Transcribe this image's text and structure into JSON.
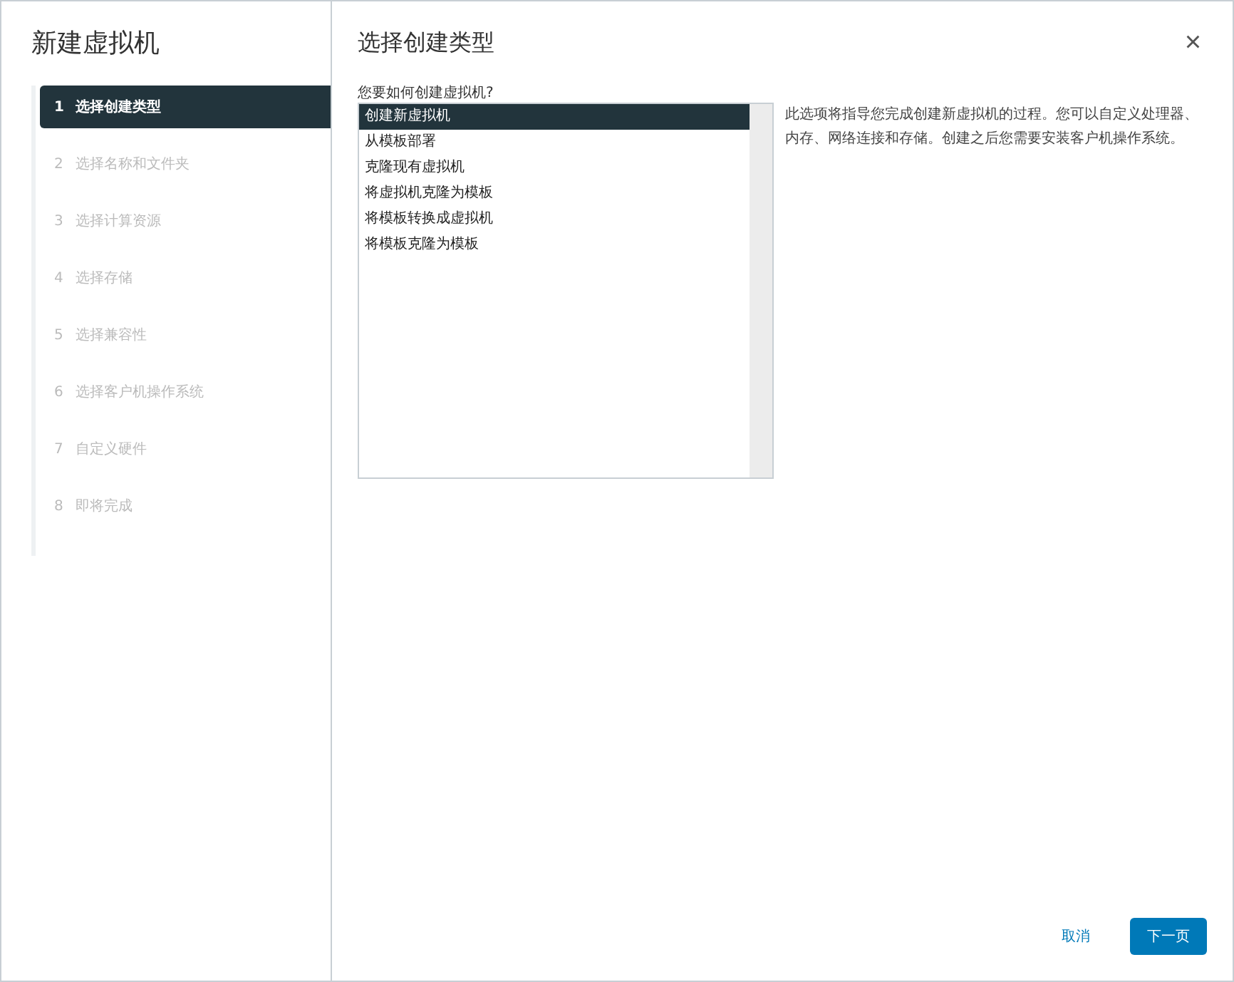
{
  "wizard": {
    "title": "新建虚拟机",
    "steps": [
      {
        "number": "1",
        "label": "选择创建类型",
        "selected": true,
        "disabled": false
      },
      {
        "number": "2",
        "label": "选择名称和文件夹",
        "selected": false,
        "disabled": true
      },
      {
        "number": "3",
        "label": "选择计算资源",
        "selected": false,
        "disabled": true
      },
      {
        "number": "4",
        "label": "选择存储",
        "selected": false,
        "disabled": true
      },
      {
        "number": "5",
        "label": "选择兼容性",
        "selected": false,
        "disabled": true
      },
      {
        "number": "6",
        "label": "选择客户机操作系统",
        "selected": false,
        "disabled": true
      },
      {
        "number": "7",
        "label": "自定义硬件",
        "selected": false,
        "disabled": true
      },
      {
        "number": "8",
        "label": "即将完成",
        "selected": false,
        "disabled": true
      }
    ]
  },
  "page": {
    "title": "选择创建类型",
    "close": "×",
    "question": "您要如何创建虚拟机?",
    "options": [
      {
        "label": "创建新虚拟机",
        "selected": true
      },
      {
        "label": "从模板部署",
        "selected": false
      },
      {
        "label": "克隆现有虚拟机",
        "selected": false
      },
      {
        "label": "将虚拟机克隆为模板",
        "selected": false
      },
      {
        "label": "将模板转换成虚拟机",
        "selected": false
      },
      {
        "label": "将模板克隆为模板",
        "selected": false
      }
    ],
    "description": "此选项将指导您完成创建新虚拟机的过程。您可以自定义处理器、内存、网络连接和存储。创建之后您需要安装客户机操作系统。"
  },
  "buttons": {
    "cancel": "取消",
    "next": "下一页"
  }
}
